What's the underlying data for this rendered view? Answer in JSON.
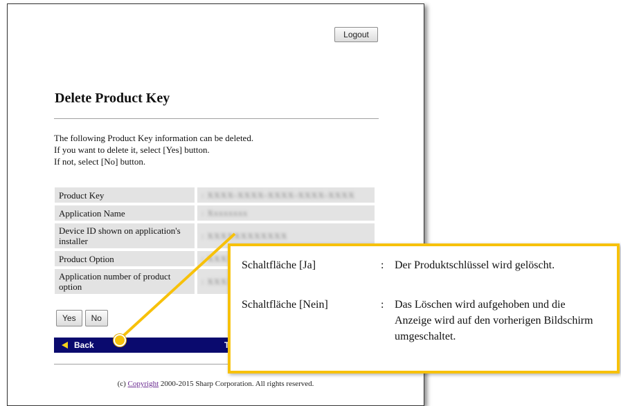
{
  "header": {
    "logout_label": "Logout"
  },
  "page": {
    "title": "Delete Product Key",
    "intro_lines": [
      "The following Product Key information can be deleted.",
      "If you want to delete it, select [Yes] button.",
      "If not, select [No] button."
    ]
  },
  "info": {
    "rows": [
      {
        "label": "Product Key",
        "value": ": XXXX-XXXX-XXXX-XXXX-XXXX"
      },
      {
        "label": "Application Name",
        "value": ": Xxxxxxxx"
      },
      {
        "label": "Device ID shown on application's installer",
        "value": ": XXXXXXXXXXXX"
      },
      {
        "label": "Product Option",
        "value": ": XXXXXXX"
      },
      {
        "label": "Application number of product option",
        "value": ": XXXX"
      }
    ]
  },
  "buttons": {
    "yes_label": "Yes",
    "no_label": "No"
  },
  "nav": {
    "back_label": "Back",
    "top_label": "Top"
  },
  "footer": {
    "prefix": "(c) ",
    "copyright_link": "Copyright",
    "suffix": " 2000-2015 Sharp Corporation. All rights reserved."
  },
  "callout": {
    "yes_term": "Schaltfläche [Ja]",
    "separator": ":",
    "yes_desc": "Der Produktschlüssel wird gelöscht.",
    "no_term": "Schaltfläche [Nein]",
    "no_desc": "Das Löschen wird aufgehoben und die Anzeige wird auf den vorherigen Bildschirm umgeschaltet."
  },
  "colors": {
    "nav_bar": "#0a0a6e",
    "accent_yellow": "#f7c10a",
    "link_visited": "#6a2a90",
    "row_background": "#e3e3e3"
  }
}
